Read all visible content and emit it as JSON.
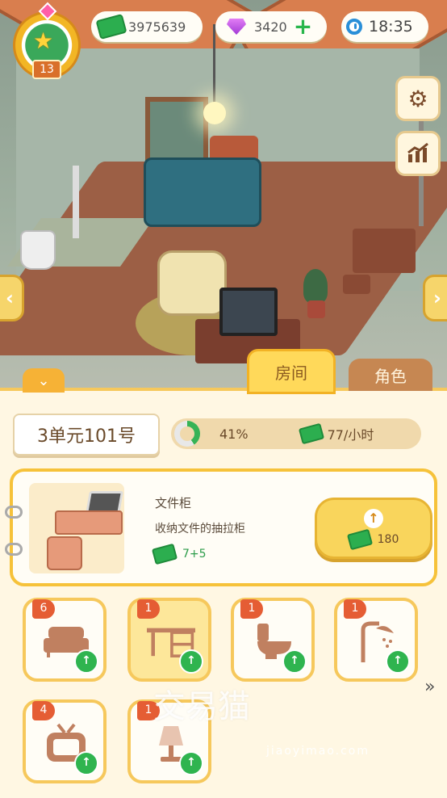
{
  "hud": {
    "level": "13",
    "cash": "3975639",
    "gems": "3420",
    "time": "18:35"
  },
  "tabs": {
    "room": "房间",
    "role": "角色"
  },
  "room": {
    "label": "3单元101号",
    "progress_percent": "41%",
    "progress_value": 41,
    "income": "77/小时"
  },
  "detail": {
    "name": "文件柜",
    "description": "收纳文件的抽拉柜",
    "gain": "7+5",
    "upgrade_cost": "180"
  },
  "items": [
    {
      "level": "6",
      "icon": "bed-icon",
      "selected": false
    },
    {
      "level": "1",
      "icon": "desk-icon",
      "selected": true
    },
    {
      "level": "1",
      "icon": "toilet-icon",
      "selected": false
    },
    {
      "level": "1",
      "icon": "shower-icon",
      "selected": false
    },
    {
      "level": "4",
      "icon": "tv-icon",
      "selected": false
    },
    {
      "level": "1",
      "icon": "lamp-icon",
      "selected": false
    }
  ],
  "watermark": {
    "main": "交易猫",
    "sub": "jiaoyimao.com"
  },
  "colors": {
    "accent": "#f6c23a",
    "cash": "#2cae4f",
    "gem": "#a23ad6",
    "badge": "#e55d34"
  }
}
